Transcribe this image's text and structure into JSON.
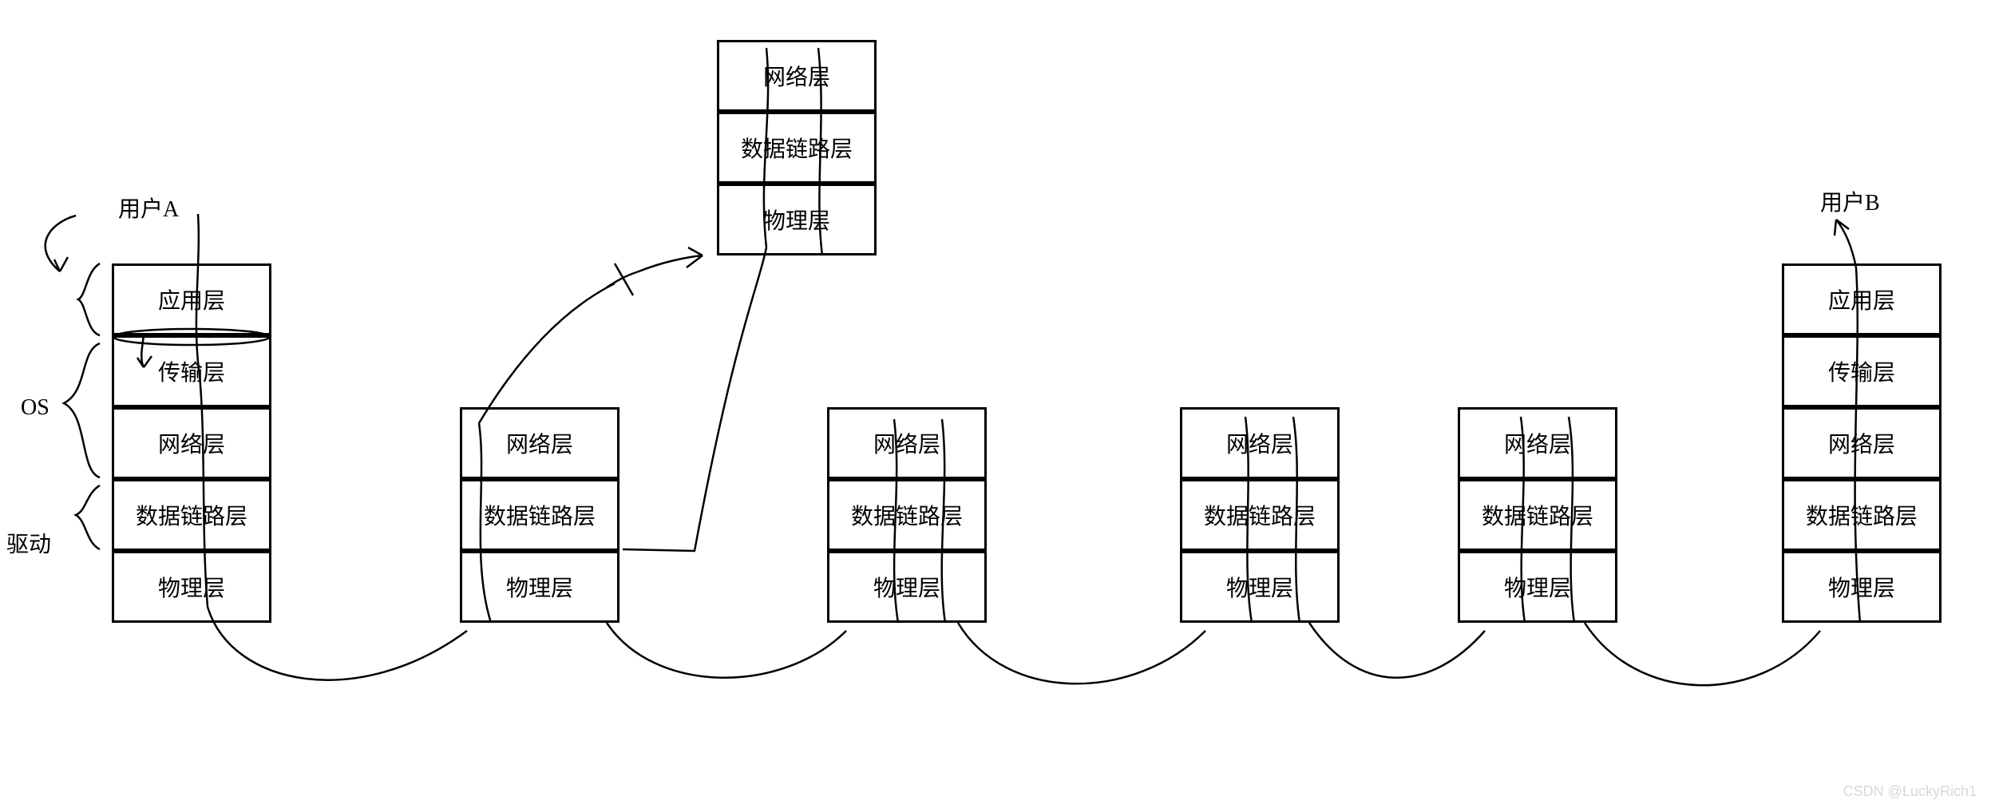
{
  "labels": {
    "user_a": "用户A",
    "user_b": "用户B",
    "os": "OS",
    "driver": "驱动",
    "watermark": "CSDN @LuckyRich1"
  },
  "stacks": {
    "user_a": {
      "app": "应用层",
      "transport": "传输层",
      "network": "网络层",
      "datalink": "数据链路层",
      "physical": "物理层"
    },
    "router_top": {
      "network": "网络层",
      "datalink": "数据链路层",
      "physical": "物理层"
    },
    "router1": {
      "network": "网络层",
      "datalink": "数据链路层",
      "physical": "物理层"
    },
    "router2": {
      "network": "网络层",
      "datalink": "数据链路层",
      "physical": "物理层"
    },
    "router3": {
      "network": "网络层",
      "datalink": "数据链路层",
      "physical": "物理层"
    },
    "router4": {
      "network": "网络层",
      "datalink": "数据链路层",
      "physical": "物理层"
    },
    "user_b": {
      "app": "应用层",
      "transport": "传输层",
      "network": "网络层",
      "datalink": "数据链路层",
      "physical": "物理层"
    }
  }
}
